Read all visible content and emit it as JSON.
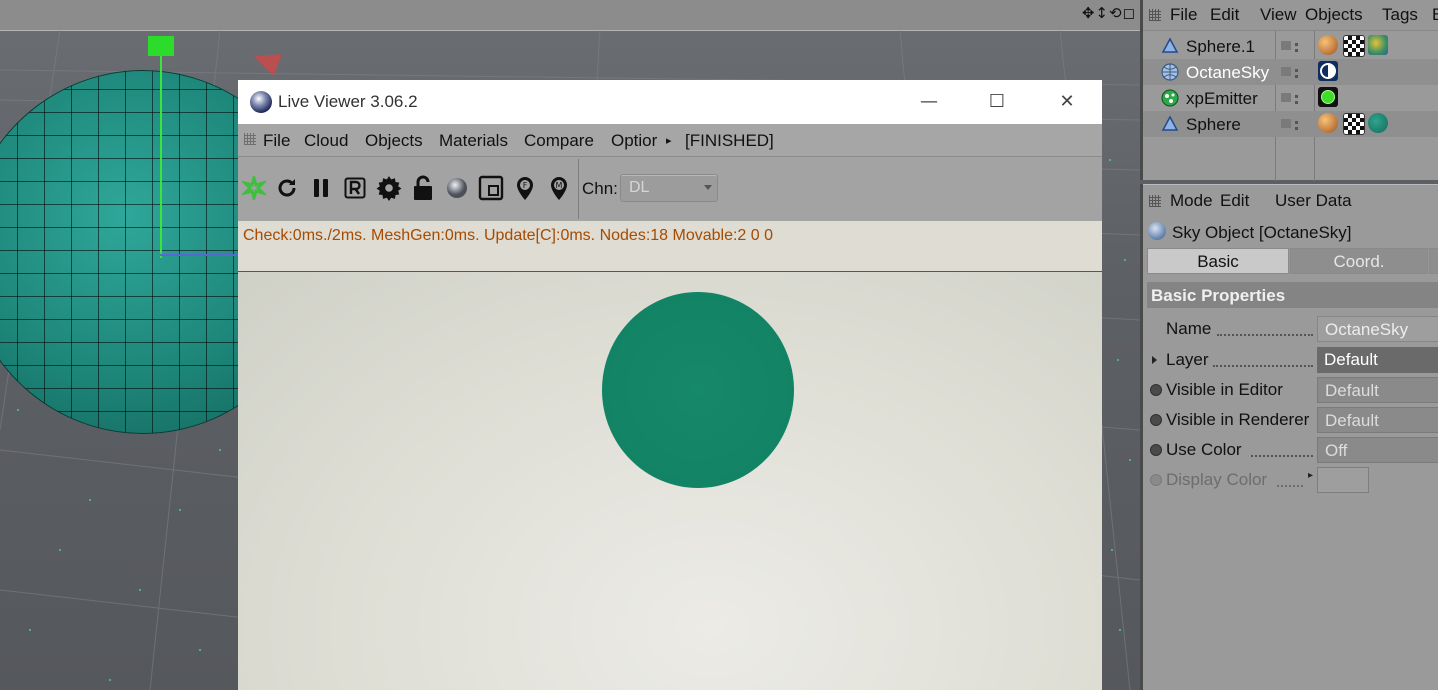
{
  "viewport": {
    "tools_glyphs": "✥↕⟲◻"
  },
  "live_viewer": {
    "title": "Live Viewer 3.06.2",
    "menu": [
      "File",
      "Cloud",
      "Objects",
      "Materials",
      "Compare",
      "Optior"
    ],
    "menu_overflow": "▸",
    "state": "[FINISHED]",
    "toolbar_icons": [
      "octane-logo-icon",
      "refresh-icon",
      "pause-icon",
      "r-icon",
      "gear-icon",
      "lock-open-icon",
      "material-ball-icon",
      "region-icon",
      "pin-f-icon",
      "pin-m-icon"
    ],
    "channel_label": "Chn:",
    "channel_value": "DL",
    "status": "Check:0ms./2ms. MeshGen:0ms. Update[C]:0ms. Nodes:18 Movable:2  0 0",
    "window_buttons": {
      "minimize": "—",
      "maximize": "☐",
      "close": "✕"
    }
  },
  "object_manager": {
    "menu": [
      "File",
      "Edit",
      "View",
      "Objects",
      "Tags",
      "B"
    ],
    "objects": [
      {
        "name": "Sphere.1",
        "icon": "sphere-object-icon",
        "selected": false
      },
      {
        "name": "OctaneSky",
        "icon": "sky-object-icon",
        "selected": true
      },
      {
        "name": "xpEmitter",
        "icon": "xp-emitter-icon",
        "selected": false
      },
      {
        "name": "Sphere",
        "icon": "sphere-object-icon",
        "selected": false
      }
    ]
  },
  "attribute_manager": {
    "menu": [
      "Mode",
      "Edit",
      "User Data"
    ],
    "header": "Sky Object [OctaneSky]",
    "tabs": [
      "Basic",
      "Coord.",
      ""
    ],
    "section": "Basic Properties",
    "properties": [
      {
        "label": "Name",
        "value": "OctaneSky"
      },
      {
        "label": "Layer",
        "value": "Default"
      },
      {
        "label": "Visible in Editor",
        "value": "Default"
      },
      {
        "label": "Visible in Renderer",
        "value": "Default"
      },
      {
        "label": "Use Color",
        "value": "Off"
      },
      {
        "label": "Display Color",
        "value": ""
      }
    ]
  },
  "colors": {
    "status_text": "#a64b00",
    "render_sphere": "#138365",
    "scene_sphere": "#1d8679",
    "selected_object_text": "#ffffff"
  }
}
